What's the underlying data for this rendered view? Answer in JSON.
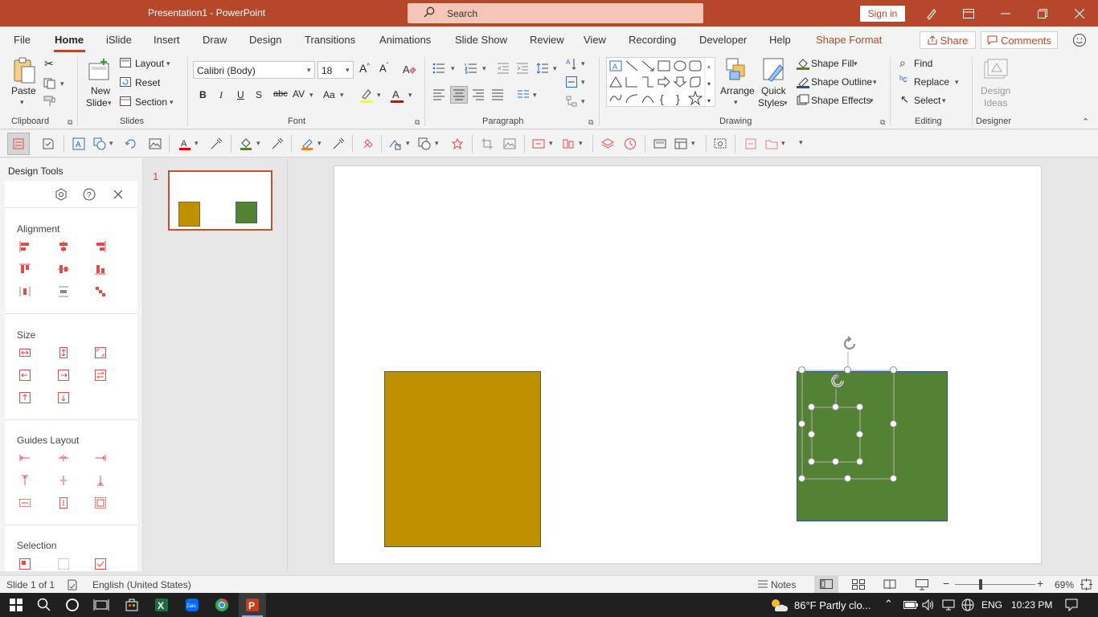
{
  "titlebar": {
    "title": "Presentation1  -  PowerPoint",
    "search_placeholder": "Search",
    "signin": "Sign in"
  },
  "tabs": [
    "File",
    "Home",
    "iSlide",
    "Insert",
    "Draw",
    "Design",
    "Transitions",
    "Animations",
    "Slide Show",
    "Review",
    "View",
    "Recording",
    "Developer",
    "Help",
    "Shape Format"
  ],
  "tabs_active": "Home",
  "share": "Share",
  "comments": "Comments",
  "ribbon": {
    "clipboard": {
      "paste": "Paste",
      "label": "Clipboard"
    },
    "slides": {
      "new_slide_1": "New",
      "new_slide_2": "Slide",
      "layout": "Layout",
      "reset": "Reset",
      "section": "Section",
      "label": "Slides"
    },
    "font": {
      "name": "Calibri (Body)",
      "size": "18",
      "label": "Font",
      "bold": "B",
      "italic": "I",
      "underline": "U",
      "shadow": "S",
      "strike": "abc",
      "spacing": "AV",
      "case": "Aa"
    },
    "paragraph": {
      "label": "Paragraph"
    },
    "drawing": {
      "arrange": "Arrange",
      "quick_styles_1": "Quick",
      "quick_styles_2": "Styles",
      "shape_fill": "Shape Fill",
      "shape_outline": "Shape Outline",
      "shape_effects": "Shape Effects",
      "label": "Drawing"
    },
    "editing": {
      "find": "Find",
      "replace": "Replace",
      "select": "Select",
      "label": "Editing"
    },
    "designer": {
      "design_ideas_1": "Design",
      "design_ideas_2": "Ideas",
      "label": "Designer"
    }
  },
  "design_tools": {
    "title": "Design Tools",
    "sections": [
      "Alignment",
      "Size",
      "Guides Layout",
      "Selection"
    ]
  },
  "thumbnails": {
    "slide_number": "1"
  },
  "slide": {
    "shape1_color": "#bf9000",
    "shape2_color": "#548235"
  },
  "statusbar": {
    "slide_info": "Slide 1 of 1",
    "language": "English (United States)",
    "notes": "Notes",
    "zoom": "69%"
  },
  "taskbar": {
    "weather": "86°F  Partly clo...",
    "lang": "ENG",
    "time": "10:23 PM"
  },
  "colors": {
    "accent": "#b7472a",
    "ribbon_bg": "#f3f3f3"
  }
}
